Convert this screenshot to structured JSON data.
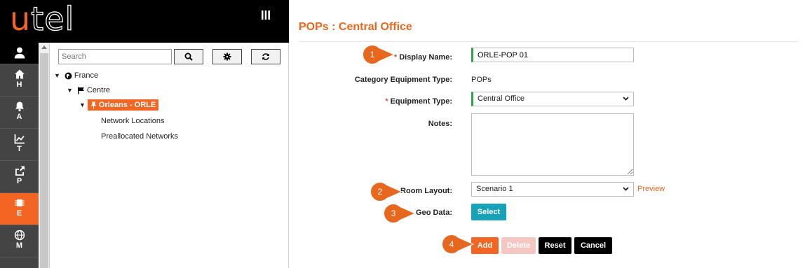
{
  "brand": {
    "logo_first": "u",
    "logo_rest": "tel",
    "menu_icon": "hamburger-icon"
  },
  "rail": [
    {
      "icon": "user-icon",
      "label": ""
    },
    {
      "icon": "home-icon",
      "label": "H"
    },
    {
      "icon": "bell-icon",
      "label": "A"
    },
    {
      "icon": "chart-icon",
      "label": "T"
    },
    {
      "icon": "share-icon",
      "label": "P"
    },
    {
      "icon": "chip-icon",
      "label": "E",
      "active": true
    },
    {
      "icon": "globe-icon",
      "label": "M"
    }
  ],
  "tree": {
    "search_placeholder": "Search",
    "buttons": [
      "search-icon",
      "gear-icon",
      "refresh-icon"
    ],
    "nodes": {
      "france": "France",
      "centre": "Centre",
      "orleans": "Orleans - ORLE",
      "network_locations": "Network Locations",
      "preallocated_networks": "Preallocated Networks"
    }
  },
  "form": {
    "title": "POPs : Central Office",
    "display_name_label": "Display Name:",
    "display_name_value": "ORLE-POP 01",
    "category_label": "Category Equipment Type:",
    "category_value": "POPs",
    "equipment_type_label": "Equipment Type:",
    "equipment_type_value": "Central Office",
    "notes_label": "Notes:",
    "room_layout_label": "Room Layout:",
    "room_layout_value": "Scenario 1",
    "preview_link": "Preview",
    "geo_data_label": "Geo Data:",
    "select_button": "Select",
    "add_button": "Add",
    "delete_button": "Delete",
    "reset_button": "Reset",
    "cancel_button": "Cancel"
  },
  "steps": [
    "1",
    "2",
    "3",
    "4"
  ],
  "colors": {
    "accent": "#f26522",
    "teal": "#17a2b8",
    "required": "#d9534f",
    "valid": "#28a745"
  }
}
